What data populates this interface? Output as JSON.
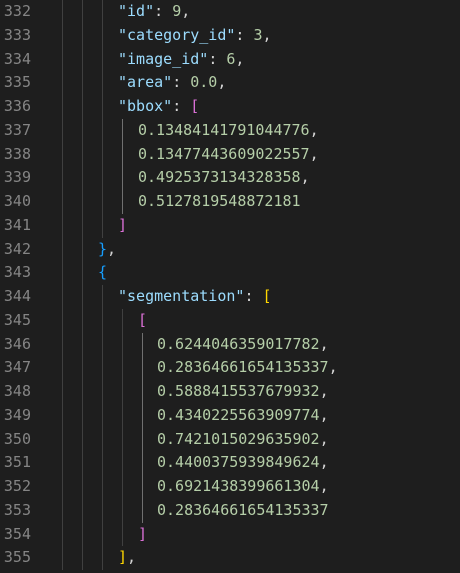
{
  "lines": [
    {
      "num": "332",
      "key": "\"id\"",
      "sep": ": ",
      "value": "9",
      "tail": ","
    },
    {
      "num": "333",
      "key": "\"category_id\"",
      "sep": ": ",
      "value": "3",
      "tail": ","
    },
    {
      "num": "334",
      "key": "\"image_id\"",
      "sep": ": ",
      "value": "6",
      "tail": ","
    },
    {
      "num": "335",
      "key": "\"area\"",
      "sep": ": ",
      "value": "0.0",
      "tail": ","
    },
    {
      "num": "336",
      "key": "\"bbox\"",
      "sep": ": ",
      "bracket": "["
    },
    {
      "num": "337",
      "value": "0.1348414179104477б",
      "tail": ","
    },
    {
      "num": "338",
      "value": "0.13477443609022557",
      "tail": ","
    },
    {
      "num": "339",
      "value": "0.4925373134328358",
      "tail": ","
    },
    {
      "num": "340",
      "value": "0.5127819548872181",
      "tail": ""
    },
    {
      "num": "341",
      "bracket": "]"
    },
    {
      "num": "342",
      "bracket": "}",
      "tail": ","
    },
    {
      "num": "343",
      "bracket": "{"
    },
    {
      "num": "344",
      "key": "\"segmentation\"",
      "sep": ": ",
      "bracket": "["
    },
    {
      "num": "345",
      "bracket": "["
    },
    {
      "num": "346",
      "value": "0.6244046359017782",
      "tail": ","
    },
    {
      "num": "347",
      "value": "0.28364661654135337",
      "tail": ","
    },
    {
      "num": "348",
      "value": "0.5888415537679932",
      "tail": ","
    },
    {
      "num": "349",
      "value": "0.4340225563909774",
      "tail": ","
    },
    {
      "num": "350",
      "value": "0.7421015029635902",
      "tail": ","
    },
    {
      "num": "351",
      "value": "0.4400375939849624",
      "tail": ","
    },
    {
      "num": "352",
      "value": "0.6921438399661304",
      "tail": ","
    },
    {
      "num": "353",
      "value": "0.28364661654135337",
      "tail": ""
    },
    {
      "num": "354",
      "bracket": "]"
    },
    {
      "num": "355",
      "bracket": "]",
      "tail": ","
    }
  ],
  "colors": {
    "background": "#1e1e1e",
    "line_number": "#858585",
    "key": "#9cdcfe",
    "number": "#b5cea8",
    "punctuation": "#d4d4d4",
    "bracket_level_1": "#ffd700",
    "bracket_level_2": "#da70d6",
    "bracket_level_3": "#179fff"
  }
}
